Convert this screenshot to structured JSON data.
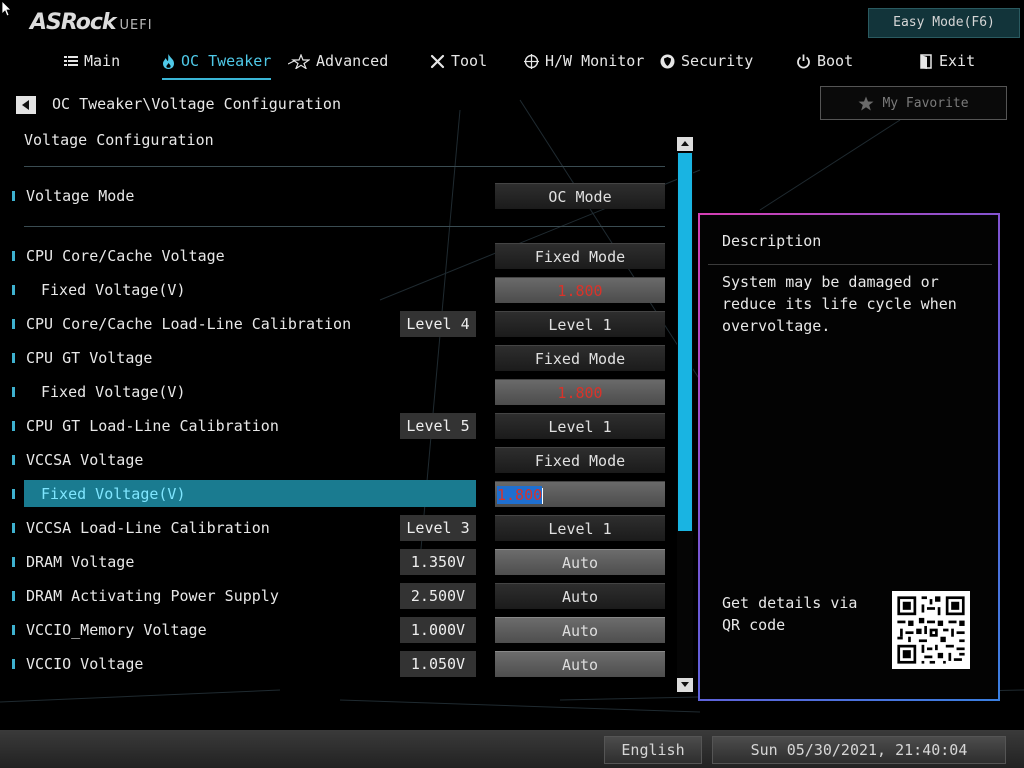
{
  "header": {
    "brand": "ASRock",
    "brand_suffix": "UEFI",
    "easy_mode_label": "Easy Mode(F6)"
  },
  "tabs": [
    {
      "label": "Main",
      "icon": "list-icon",
      "active": false
    },
    {
      "label": "OC Tweaker",
      "icon": "flame-icon",
      "active": true
    },
    {
      "label": "Advanced",
      "icon": "star-icon",
      "active": false
    },
    {
      "label": "Tool",
      "icon": "tools-icon",
      "active": false
    },
    {
      "label": "H/W Monitor",
      "icon": "crosshair-icon",
      "active": false
    },
    {
      "label": "Security",
      "icon": "shield-icon",
      "active": false
    },
    {
      "label": "Boot",
      "icon": "power-icon",
      "active": false
    },
    {
      "label": "Exit",
      "icon": "exit-door-icon",
      "active": false
    }
  ],
  "breadcrumb": "OC Tweaker\\Voltage Configuration",
  "favorite_label": "My Favorite",
  "section_title": "Voltage Configuration",
  "rows": [
    {
      "label": "Voltage Mode",
      "current": "",
      "setting": "OC Mode",
      "style": "dark"
    },
    {
      "label": "CPU Core/Cache Voltage",
      "current": "",
      "setting": "Fixed Mode",
      "style": "dark"
    },
    {
      "label": "Fixed Voltage(V)",
      "current": "",
      "setting": "1.800",
      "style": "red"
    },
    {
      "label": "CPU Core/Cache Load-Line Calibration",
      "current": "Level 4",
      "setting": "Level 1",
      "style": "dark"
    },
    {
      "label": "CPU GT Voltage",
      "current": "",
      "setting": "Fixed Mode",
      "style": "dark"
    },
    {
      "label": "Fixed Voltage(V)",
      "current": "",
      "setting": "1.800",
      "style": "red"
    },
    {
      "label": "CPU GT Load-Line Calibration",
      "current": "Level 5",
      "setting": "Level 1",
      "style": "dark"
    },
    {
      "label": "VCCSA Voltage",
      "current": "",
      "setting": "Fixed Mode",
      "style": "dark"
    },
    {
      "label": "Fixed Voltage(V)",
      "current": "",
      "setting": "1.800",
      "style": "editing",
      "selected": true
    },
    {
      "label": "VCCSA Load-Line Calibration",
      "current": "Level 3",
      "setting": "Level 1",
      "style": "dark"
    },
    {
      "label": "DRAM Voltage",
      "current": "1.350V",
      "setting": "Auto",
      "style": "light"
    },
    {
      "label": "DRAM Activating Power Supply",
      "current": "2.500V",
      "setting": "Auto",
      "style": "dark"
    },
    {
      "label": "VCCIO_Memory Voltage",
      "current": "1.000V",
      "setting": "Auto",
      "style": "light"
    },
    {
      "label": "VCCIO Voltage",
      "current": "1.050V",
      "setting": "Auto",
      "style": "light"
    }
  ],
  "description": {
    "title": "Description",
    "text": "System may be damaged or reduce its life cycle when overvoltage.",
    "qr_text": "Get details via QR code"
  },
  "footer": {
    "language": "English",
    "datetime": "Sun 05/30/2021, 21:40:04"
  },
  "colors": {
    "accent": "#19b4e2",
    "selected_row": "#1a7b90",
    "warning_value": "#d8332a"
  }
}
